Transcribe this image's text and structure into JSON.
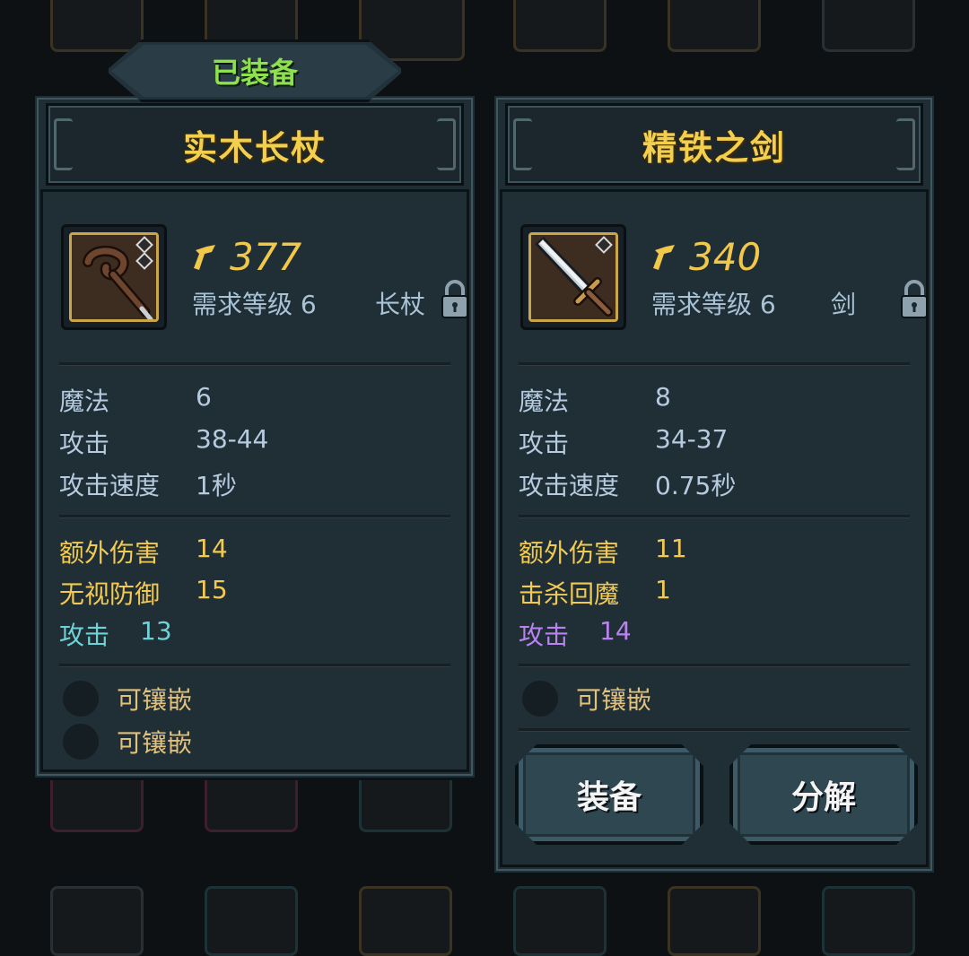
{
  "equipped_tag": "已装备",
  "left_item": {
    "name": "实木长杖",
    "power": "377",
    "req_level": "需求等级 6",
    "type": "长杖",
    "stats": [
      {
        "label": "魔法",
        "value": "6"
      },
      {
        "label": "攻击",
        "value": "38-44"
      },
      {
        "label": "攻击速度",
        "value": "1秒"
      }
    ],
    "bonus": [
      {
        "label": "额外伤害",
        "value": "14"
      },
      {
        "label": "无视防御",
        "value": "15"
      }
    ],
    "special": {
      "label": "攻击",
      "value": "13",
      "color": "#6fd2d6"
    },
    "sockets": [
      "可镶嵌",
      "可镶嵌"
    ],
    "icon": "wooden-staff-icon"
  },
  "right_item": {
    "name": "精铁之剑",
    "power": "340",
    "req_level": "需求等级 6",
    "type": "剑",
    "stats": [
      {
        "label": "魔法",
        "value": "8"
      },
      {
        "label": "攻击",
        "value": "34-37"
      },
      {
        "label": "攻击速度",
        "value": "0.75秒"
      }
    ],
    "bonus": [
      {
        "label": "额外伤害",
        "value": "11"
      },
      {
        "label": "击杀回魔",
        "value": "1"
      }
    ],
    "special": {
      "label": "攻击",
      "value": "14",
      "color": "#b982f0"
    },
    "sockets": [
      "可镶嵌"
    ],
    "icon": "iron-sword-icon"
  },
  "buttons": {
    "equip": "装备",
    "disassemble": "分解"
  },
  "colors": {
    "title_gold": "#f3cf4e",
    "equipped_green": "#8fe04f",
    "panel_bg": "#1f2d34"
  }
}
